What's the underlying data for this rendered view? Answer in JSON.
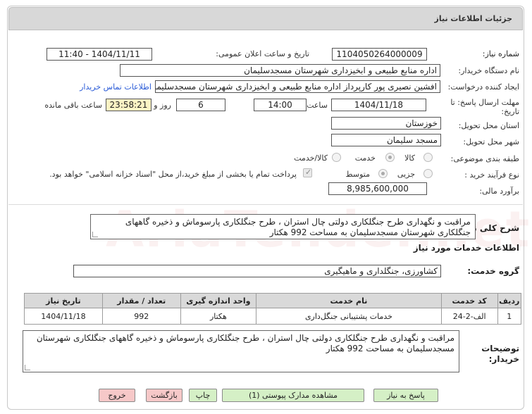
{
  "header": {
    "title": "جزئیات اطلاعات نیاز"
  },
  "watermark": "AriaTender.net",
  "fields": {
    "need_number_label": "شماره نیاز:",
    "need_number": "1104050264000009",
    "announce_label": "تاریخ و ساعت اعلان عمومی:",
    "announce_value": "1404/11/11 - 11:40",
    "buyer_org_label": "نام دستگاه خریدار:",
    "buyer_org": "اداره منابع طبیعی و ابخیزداری شهرستان مسجدسلیمان",
    "creator_label": "ایجاد کننده درخواست:",
    "creator": "افشین نصیری پور کارپرداز اداره منابع طبیعی و ابخیزداری شهرستان مسجدسلیمان",
    "contact_link": "اطلاعات تماس خریدار",
    "deadline_label_1": "مهلت ارسال پاسخ: تا",
    "deadline_label_2": "تاریخ:",
    "deadline_date": "1404/11/18",
    "time_label": "ساعت",
    "deadline_time": "14:00",
    "days_value": "6",
    "days_label": "روز و",
    "remaining_time": "23:58:21",
    "remaining_label": "ساعت باقی مانده",
    "province_label": "استان محل تحویل:",
    "province": "خوزستان",
    "city_label": "شهر محل تحویل:",
    "city": "مسجد سلیمان",
    "category_label": "طبقه بندی موضوعی:",
    "category_options": [
      "کالا",
      "خدمت",
      "کالا/خدمت"
    ],
    "category_selected": 1,
    "process_label": "نوع فرآیند خرید :",
    "process_options": [
      "جزیی",
      "متوسط"
    ],
    "process_selected": 1,
    "payment_note": "پرداخت تمام یا بخشی از مبلغ خرید،از محل \"اسناد خزانه اسلامی\" خواهد بود.",
    "budget_label": "برآورد مالی:",
    "budget": "8,985,600,000"
  },
  "summary": {
    "label": "شرح کلی نیاز:",
    "text": "مراقبت و نگهداری طرح جنگلکاری دولتی چال استران ، طرح جنگلکاری پارسوماش و ذخیره گاههای جنگلکاری شهرستان مسجدسلیمان به مساحت 992 هکتار"
  },
  "services": {
    "section_title": "اطلاعات خدمات مورد نیاز",
    "group_label": "گروه خدمت:",
    "group_value": "کشاورزی، جنگلداری و ماهیگیری",
    "columns": [
      "ردیف",
      "کد خدمت",
      "نام خدمت",
      "واحد اندازه گیری",
      "تعداد / مقدار",
      "تاریخ نیاز"
    ],
    "rows": [
      [
        "1",
        "الف-2-24",
        "خدمات پشتیبانی جنگل‌داری",
        "هکتار",
        "992",
        "1404/11/18"
      ]
    ]
  },
  "buyer_notes": {
    "label_1": "توضیحات",
    "label_2": "خریدار:",
    "text": "مراقبت و نگهداری طرح جنگلکاری دولتی چال استران ، طرح جنگلکاری پارسوماش و ذخیره گاههای جنگلکاری شهرستان مسجدسلیمان به مساحت 992 هکتار"
  },
  "buttons": {
    "reply": "پاسخ به نیاز",
    "view_docs": "مشاهده مدارک پیوستی (1)",
    "print": "چاپ",
    "back": "بازگشت",
    "exit": "خروج"
  },
  "colors": {
    "reply_bg": "#d5f0c6",
    "exit_bg": "#f6c8c8",
    "link": "#2a5bd7",
    "timer_bg": "#fbf3c4"
  }
}
